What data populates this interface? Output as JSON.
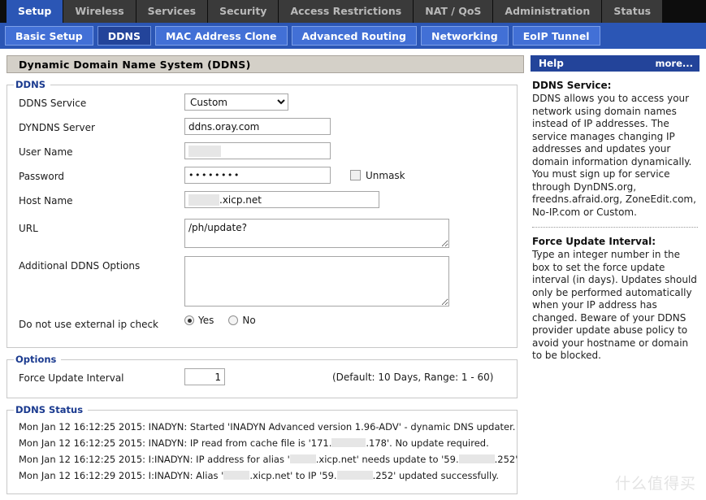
{
  "main_tabs": [
    {
      "label": "Setup",
      "active": true
    },
    {
      "label": "Wireless",
      "active": false
    },
    {
      "label": "Services",
      "active": false
    },
    {
      "label": "Security",
      "active": false
    },
    {
      "label": "Access Restrictions",
      "active": false
    },
    {
      "label": "NAT / QoS",
      "active": false
    },
    {
      "label": "Administration",
      "active": false
    },
    {
      "label": "Status",
      "active": false
    }
  ],
  "sub_tabs": [
    {
      "label": "Basic Setup",
      "active": false
    },
    {
      "label": "DDNS",
      "active": true
    },
    {
      "label": "MAC Address Clone",
      "active": false
    },
    {
      "label": "Advanced Routing",
      "active": false
    },
    {
      "label": "Networking",
      "active": false
    },
    {
      "label": "EoIP Tunnel",
      "active": false
    }
  ],
  "page_title": "Dynamic Domain Name System (DDNS)",
  "ddns_section": {
    "legend": "DDNS",
    "service_label": "DDNS Service",
    "service_value": "Custom",
    "service_options": [
      "Custom"
    ],
    "server_label": "DYNDNS Server",
    "server_value": "ddns.oray.com",
    "username_label": "User Name",
    "username_value": "",
    "password_label": "Password",
    "password_value": "••••••••",
    "unmask_label": "Unmask",
    "unmask_checked": false,
    "hostname_label": "Host Name",
    "hostname_suffix": ".xicp.net",
    "url_label": "URL",
    "url_value": "/ph/update?",
    "additional_label": "Additional DDNS Options",
    "additional_value": "",
    "external_ip_label": "Do not use external ip check",
    "external_ip_yes": "Yes",
    "external_ip_no": "No",
    "external_ip_selected": "Yes"
  },
  "options_section": {
    "legend": "Options",
    "force_label": "Force Update Interval",
    "force_value": "1",
    "force_hint": "(Default: 10 Days, Range: 1 - 60)"
  },
  "status_section": {
    "legend": "DDNS Status",
    "lines": [
      {
        "parts": [
          {
            "type": "text",
            "value": "Mon Jan 12 16:12:25 2015: INADYN: Started 'INADYN Advanced version 1.96-ADV' - dynamic DNS updater."
          }
        ]
      },
      {
        "parts": [
          {
            "type": "text",
            "value": "Mon Jan 12 16:12:25 2015: INADYN: IP read from cache file is '171."
          },
          {
            "type": "redact",
            "style": "ip1"
          },
          {
            "type": "text",
            "value": ".178'. No update required."
          }
        ]
      },
      {
        "parts": [
          {
            "type": "text",
            "value": "Mon Jan 12 16:12:25 2015: I:INADYN: IP address for alias '"
          },
          {
            "type": "redact",
            "style": "alias"
          },
          {
            "type": "text",
            "value": ".xicp.net' needs update to '59."
          },
          {
            "type": "redact",
            "style": "ip2"
          },
          {
            "type": "text",
            "value": ".252'"
          }
        ]
      },
      {
        "parts": [
          {
            "type": "text",
            "value": "Mon Jan 12 16:12:29 2015: I:INADYN: Alias '"
          },
          {
            "type": "redact",
            "style": "alias"
          },
          {
            "type": "text",
            "value": ".xicp.net' to IP '59."
          },
          {
            "type": "redact",
            "style": "ip2"
          },
          {
            "type": "text",
            "value": ".252' updated successfully."
          }
        ]
      }
    ]
  },
  "help": {
    "title": "Help",
    "more_label": "more...",
    "sections": [
      {
        "heading": "DDNS Service:",
        "body": "DDNS allows you to access your network using domain names instead of IP addresses. The service manages changing IP addresses and updates your domain information dynamically. You must sign up for service through DynDNS.org, freedns.afraid.org, ZoneEdit.com, No-IP.com or Custom."
      },
      {
        "heading": "Force Update Interval:",
        "body": "Type an integer number in the box to set the force update interval (in days). Updates should only be performed automatically when your IP address has changed. Beware of your DDNS provider update abuse policy to avoid your hostname or domain to be blocked."
      }
    ]
  },
  "watermark": "什么值得买",
  "colors": {
    "accent_blue": "#2b56b5",
    "dark_blue": "#23449a",
    "subtab_blue": "#4270d6",
    "titlebar_gray": "#d4d0c8"
  }
}
